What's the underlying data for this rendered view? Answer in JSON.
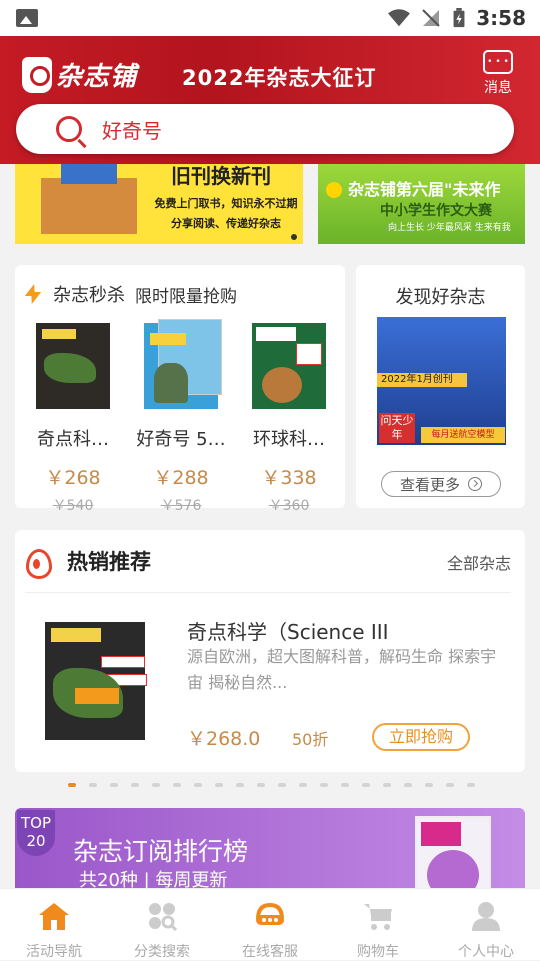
{
  "status_bar": {
    "time": "3:58"
  },
  "header": {
    "logo_text": "杂志铺",
    "banner_title": "2022年杂志大征订",
    "message_label": "消息",
    "search_placeholder": "好奇号"
  },
  "banners": [
    {
      "title": "旧刊换新刊",
      "line1": "免费上门取书，知识永不过期",
      "line2": "分享阅读、传递好杂志"
    },
    {
      "title": "杂志铺第六届\"未来作",
      "line1": "中小学生作文大赛",
      "line2": "向上生长  少年最风采  生来有我"
    }
  ],
  "flash_sale": {
    "title": "杂志秒杀",
    "subtitle": "限时限量抢购",
    "products": [
      {
        "name": "奇点科…",
        "price": "￥268",
        "old_price": "￥540",
        "cover_color": "#2e2a26"
      },
      {
        "name": "好奇号 5…",
        "price": "￥288",
        "old_price": "￥576",
        "cover_color": "#3aa0d9"
      },
      {
        "name": "环球科…",
        "price": "￥338",
        "old_price": "￥360",
        "cover_color": "#1f6b3a"
      }
    ]
  },
  "discover": {
    "title": "发现好杂志",
    "cover_line1": "2022年1月创刊",
    "cover_line2": "问天少年",
    "cover_line3": "每月送航空模型",
    "more_label": "查看更多"
  },
  "hot": {
    "title": "热销推荐",
    "all_label": "全部杂志",
    "item": {
      "name": "奇点科学（Science III",
      "desc": "源自欧洲，超大图解科普，解码生命 探索宇宙 揭秘自然...",
      "price": "￥268.0",
      "discount": "50折",
      "buy_label": "立即抢购"
    }
  },
  "pager": {
    "total": 20,
    "active": 0
  },
  "ranking": {
    "badge_top": "TOP",
    "badge_num": "20",
    "title": "杂志订阅排行榜",
    "subtitle": "共20种  |  每周更新"
  },
  "tabbar": {
    "items": [
      {
        "label": "活动导航",
        "icon": "home-icon",
        "color": "#f08a1c"
      },
      {
        "label": "分类搜索",
        "icon": "category-search-icon",
        "color": "#cccccc"
      },
      {
        "label": "在线客服",
        "icon": "customer-service-icon",
        "color": "#f08a1c"
      },
      {
        "label": "购物车",
        "icon": "cart-icon",
        "color": "#cccccc"
      },
      {
        "label": "个人中心",
        "icon": "user-icon",
        "color": "#cccccc"
      }
    ]
  },
  "colors": {
    "brand_red": "#c41b25",
    "accent_orange": "#f08a1c",
    "price_gold": "#c68a4a"
  }
}
